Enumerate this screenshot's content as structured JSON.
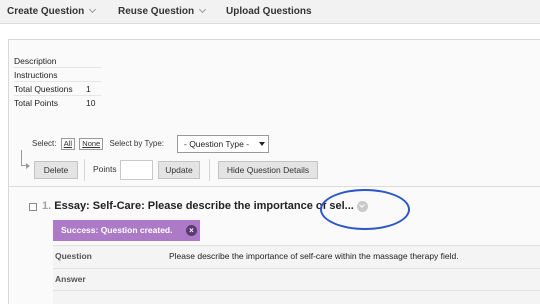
{
  "topnav": {
    "create_question": "Create Question",
    "reuse_question": "Reuse Question",
    "upload_questions": "Upload Questions"
  },
  "info": {
    "description_label": "Description",
    "instructions_label": "Instructions",
    "total_questions_label": "Total Questions",
    "total_questions_value": "1",
    "total_points_label": "Total Points",
    "total_points_value": "10"
  },
  "select": {
    "select_label": "Select:",
    "all_link": "All",
    "none_link": "None",
    "by_type_label": "Select by Type:",
    "type_value": "- Question Type -"
  },
  "toolbar": {
    "delete_label": "Delete",
    "points_label": "Points",
    "points_value": "",
    "update_label": "Update",
    "hide_details_label": "Hide Question Details"
  },
  "question": {
    "number": "1.",
    "title": "Essay: Self-Care: Please describe the importance of sel...",
    "success_message": "Success: Question created.",
    "close_glyph": "×",
    "question_label": "Question",
    "question_text": "Please describe the importance of self-care within the massage therapy field.",
    "answer_label": "Answer"
  },
  "colors": {
    "success_bg": "#ac7ac6",
    "annotation_ring": "#2a56c6"
  }
}
